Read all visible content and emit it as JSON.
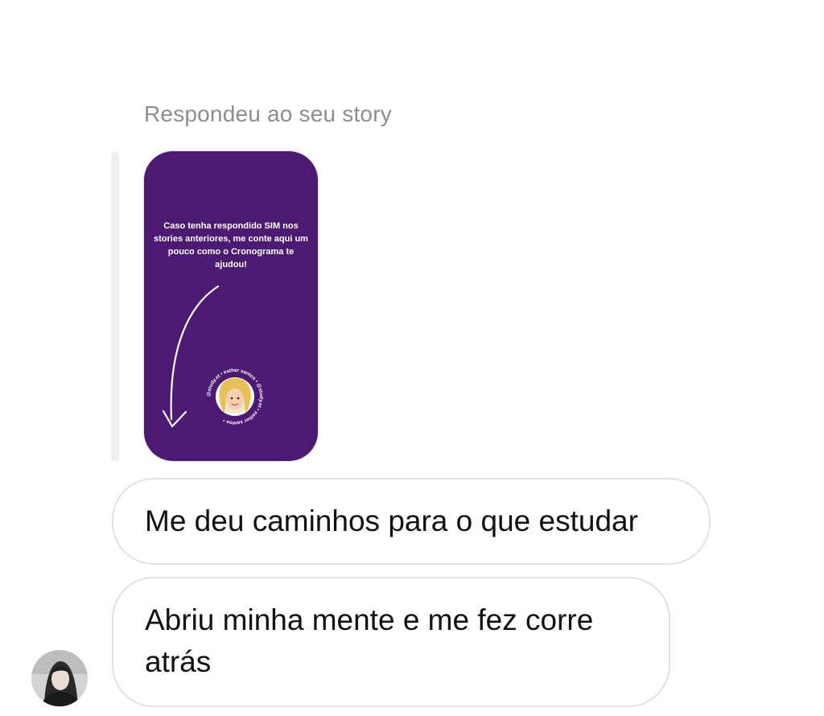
{
  "thread": {
    "reply_label": "Respondeu ao seu story"
  },
  "story": {
    "background_color": "#4c1a73",
    "text": "Caso tenha respondido SIM nos stories anteriores, me conte aqui um pouco como o Cronograma te ajudou!",
    "sticker_ring_text": "@study.et • esther santos • @study.et • esther santos •"
  },
  "messages": [
    {
      "text": "Me deu caminhos para o que estudar"
    },
    {
      "text": "Abriu minha mente e me fez corre atrás"
    }
  ],
  "sender": {
    "avatar_icon": "user-avatar"
  }
}
